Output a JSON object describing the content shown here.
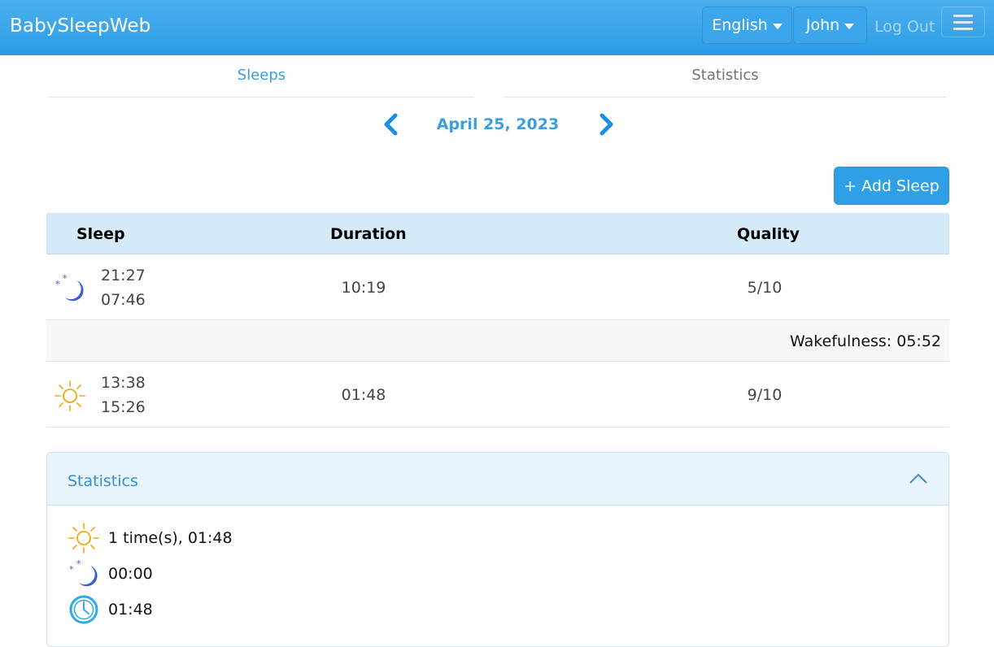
{
  "navbar": {
    "brand": "BabySleepWeb",
    "language": "English",
    "user": "John",
    "logout": "Log Out"
  },
  "tabs": {
    "sleeps": "Sleeps",
    "statistics": "Statistics"
  },
  "date": {
    "label": "April 25, 2023"
  },
  "add_button": "+ Add Sleep",
  "table": {
    "headers": {
      "sleep": "Sleep",
      "duration": "Duration",
      "quality": "Quality"
    },
    "rows": [
      {
        "type": "night",
        "icon": "moon-icon",
        "start": "21:27",
        "end": "07:46",
        "duration": "10:19",
        "quality": "5/10"
      },
      {
        "type": "day",
        "icon": "sun-icon",
        "start": "13:38",
        "end": "15:26",
        "duration": "01:48",
        "quality": "9/10"
      }
    ],
    "wakefulness": "Wakefulness: 05:52"
  },
  "statistics": {
    "title": "Statistics",
    "day_sleep": "1 time(s), 01:48",
    "night_sleep": "00:00",
    "total": "01:48"
  },
  "colors": {
    "navbar": "#2b9ce6",
    "accent": "#3a9fe0",
    "moon": "#3a5fcf",
    "sun": "#f3a712",
    "clock": "#2fa9e8"
  }
}
